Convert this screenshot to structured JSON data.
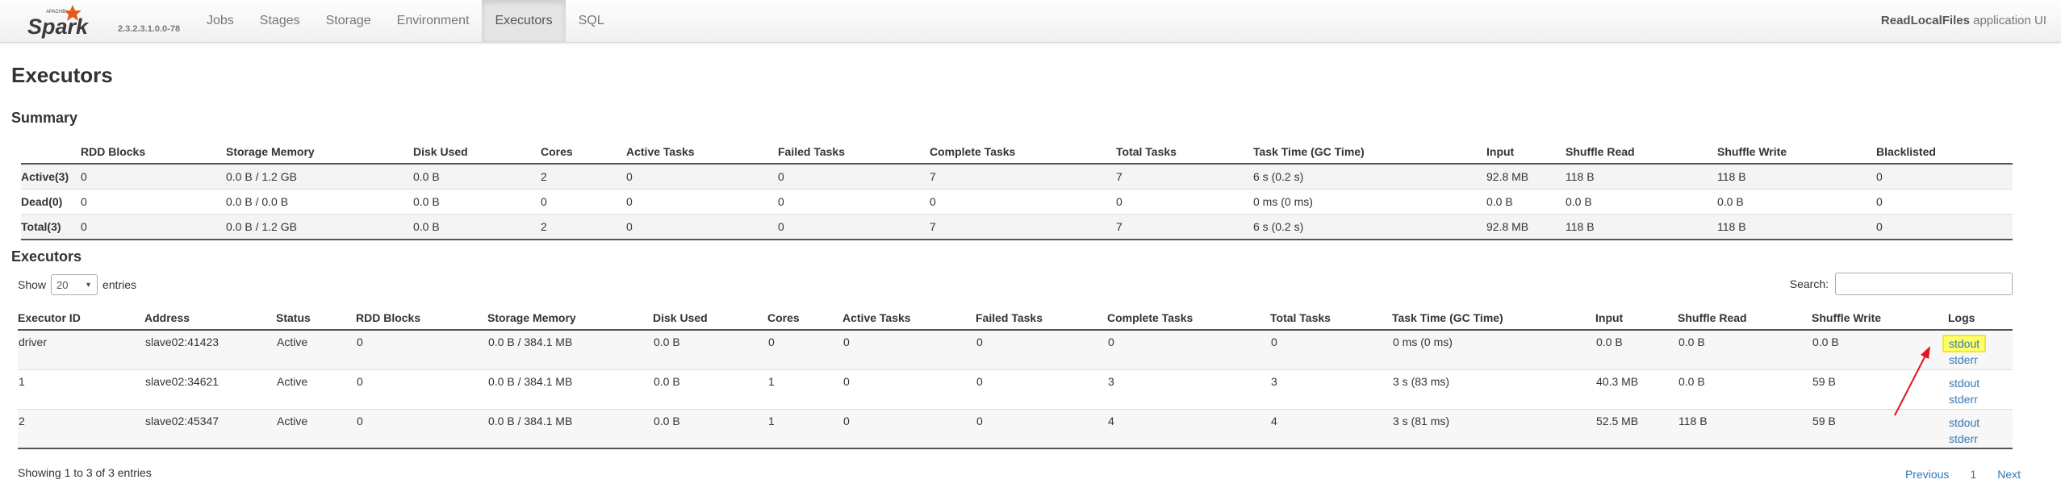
{
  "navbar": {
    "brand_small": "APACHE",
    "brand_name": "Spark",
    "version": "2.3.2.3.1.0.0-78",
    "tabs": [
      "Jobs",
      "Stages",
      "Storage",
      "Environment",
      "Executors",
      "SQL"
    ],
    "active_tab": "Executors",
    "app_name": "ReadLocalFiles",
    "app_suffix": "application UI"
  },
  "page": {
    "title": "Executors"
  },
  "summary": {
    "heading": "Summary",
    "columns": [
      "",
      "RDD Blocks",
      "Storage Memory",
      "Disk Used",
      "Cores",
      "Active Tasks",
      "Failed Tasks",
      "Complete Tasks",
      "Total Tasks",
      "Task Time (GC Time)",
      "Input",
      "Shuffle Read",
      "Shuffle Write",
      "Blacklisted"
    ],
    "rows": [
      [
        "Active(3)",
        "0",
        "0.0 B / 1.2 GB",
        "0.0 B",
        "2",
        "0",
        "0",
        "7",
        "7",
        "6 s (0.2 s)",
        "92.8 MB",
        "118 B",
        "118 B",
        "0"
      ],
      [
        "Dead(0)",
        "0",
        "0.0 B / 0.0 B",
        "0.0 B",
        "0",
        "0",
        "0",
        "0",
        "0",
        "0 ms (0 ms)",
        "0.0 B",
        "0.0 B",
        "0.0 B",
        "0"
      ],
      [
        "Total(3)",
        "0",
        "0.0 B / 1.2 GB",
        "0.0 B",
        "2",
        "0",
        "0",
        "7",
        "7",
        "6 s (0.2 s)",
        "92.8 MB",
        "118 B",
        "118 B",
        "0"
      ]
    ]
  },
  "executors": {
    "heading": "Executors",
    "show_label": "Show",
    "page_size": "20",
    "entries_label": "entries",
    "search_label": "Search:",
    "columns": [
      "Executor ID",
      "Address",
      "Status",
      "RDD Blocks",
      "Storage Memory",
      "Disk Used",
      "Cores",
      "Active Tasks",
      "Failed Tasks",
      "Complete Tasks",
      "Total Tasks",
      "Task Time (GC Time)",
      "Input",
      "Shuffle Read",
      "Shuffle Write",
      "Logs"
    ],
    "rows": [
      [
        "driver",
        "slave02:41423",
        "Active",
        "0",
        "0.0 B / 384.1 MB",
        "0.0 B",
        "0",
        "0",
        "0",
        "0",
        "0",
        "0 ms (0 ms)",
        "0.0 B",
        "0.0 B",
        "0.0 B"
      ],
      [
        "1",
        "slave02:34621",
        "Active",
        "0",
        "0.0 B / 384.1 MB",
        "0.0 B",
        "1",
        "0",
        "0",
        "3",
        "3",
        "3 s (83 ms)",
        "40.3 MB",
        "0.0 B",
        "59 B"
      ],
      [
        "2",
        "slave02:45347",
        "Active",
        "0",
        "0.0 B / 384.1 MB",
        "0.0 B",
        "1",
        "0",
        "0",
        "4",
        "4",
        "3 s (81 ms)",
        "52.5 MB",
        "118 B",
        "59 B"
      ]
    ],
    "log_stdout": "stdout",
    "log_stderr": "stderr",
    "info": "Showing 1 to 3 of 3 entries",
    "pager": {
      "previous": "Previous",
      "page": "1",
      "next": "Next"
    }
  },
  "colors": {
    "link": "#337ab7",
    "highlight": "#ffff66",
    "arrow": "#e0141e"
  }
}
